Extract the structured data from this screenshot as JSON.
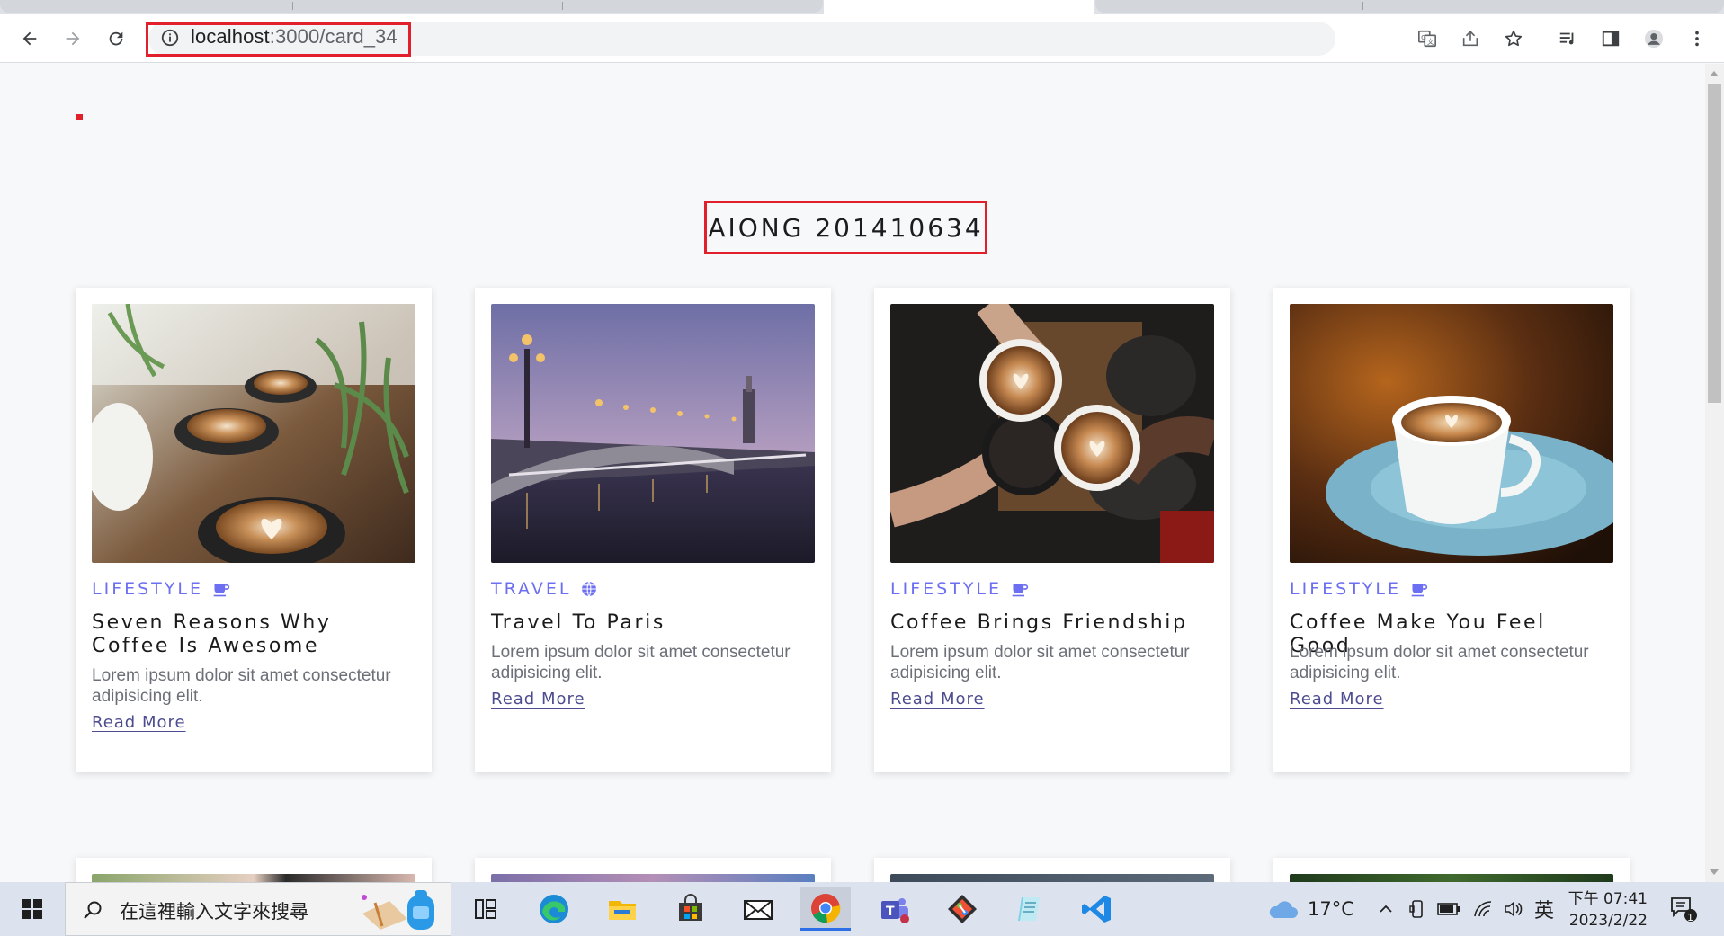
{
  "browser": {
    "url_host": "localhost",
    "url_path": ":3000/card_34",
    "icons": [
      "back-icon",
      "forward-icon",
      "reload-icon",
      "info-icon",
      "translate-icon",
      "share-icon",
      "star-icon",
      "media-icon",
      "side-panel-icon",
      "profile-icon",
      "menu-icon"
    ]
  },
  "page": {
    "title": "AIONG 201410634",
    "read_more_label": "Read More",
    "cards": [
      {
        "category": "LIFESTYLE",
        "category_icon": "coffee-icon",
        "title": "Seven Reasons Why Coffee Is Awesome",
        "description": "Lorem ipsum dolor sit amet consectetur adipisicing elit."
      },
      {
        "category": "TRAVEL",
        "category_icon": "globe-icon",
        "title": "Travel To Paris",
        "description": "Lorem ipsum dolor sit amet consectetur adipisicing elit."
      },
      {
        "category": "LIFESTYLE",
        "category_icon": "coffee-icon",
        "title": "Coffee Brings Friendship",
        "description": "Lorem ipsum dolor sit amet consectetur adipisicing elit."
      },
      {
        "category": "LIFESTYLE",
        "category_icon": "coffee-icon",
        "title": "Coffee Make You Feel Good",
        "description": "Lorem ipsum dolor sit amet consectetur adipisicing elit."
      }
    ]
  },
  "colors": {
    "accent": "#6d6ff2",
    "link": "#4d4c8f",
    "highlight": "#e2202b",
    "background": "#f7f8fa"
  },
  "taskbar": {
    "search_placeholder": "在這裡輸入文字來搜尋",
    "weather": "17°C",
    "ime": "英",
    "time": "下午 07:41",
    "date": "2023/2/22",
    "notification_count": "1",
    "apps": [
      "task-view-icon",
      "edge-icon",
      "file-explorer-icon",
      "store-icon",
      "mail-icon",
      "chrome-icon",
      "teams-icon",
      "git-icon",
      "notepad-icon",
      "vscode-icon"
    ]
  }
}
